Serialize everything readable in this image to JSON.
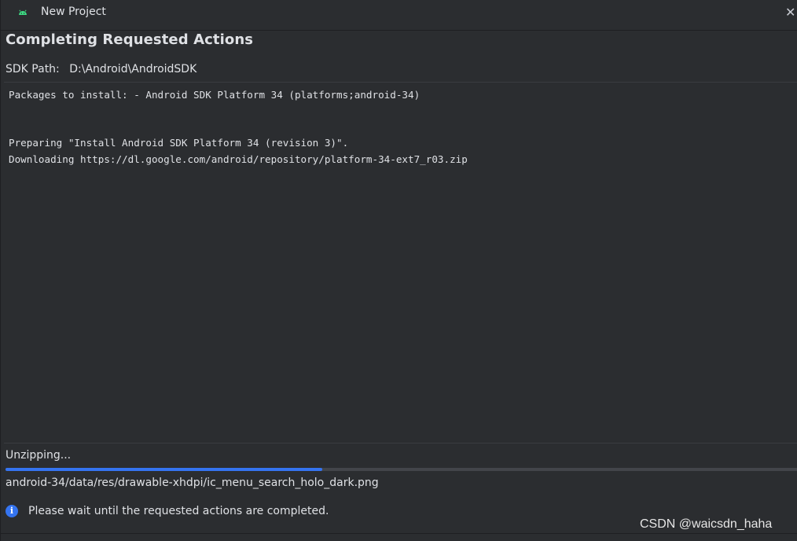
{
  "window": {
    "title": "New Project",
    "app_icon": "android-icon",
    "close_glyph": "✕"
  },
  "page": {
    "heading": "Completing Requested Actions",
    "sdk_path_label": "SDK Path:",
    "sdk_path_value": "D:\\Android\\AndroidSDK"
  },
  "log": {
    "lines": [
      "Packages to install: - Android SDK Platform 34 (platforms;android-34)",
      "",
      "",
      "Preparing \"Install Android SDK Platform 34 (revision 3)\".",
      "Downloading https://dl.google.com/android/repository/platform-34-ext7_r03.zip"
    ]
  },
  "progress": {
    "status": "Unzipping...",
    "fraction": 0.4,
    "current_file": "android-34/data/res/drawable-xhdpi/ic_menu_search_holo_dark.png"
  },
  "info": {
    "icon": "info-icon",
    "message": "Please wait until the requested actions are completed."
  },
  "watermark": "CSDN @waicsdn_haha",
  "colors": {
    "background": "#2b2d30",
    "accent": "#3574f0",
    "android_green": "#3ddc84"
  }
}
